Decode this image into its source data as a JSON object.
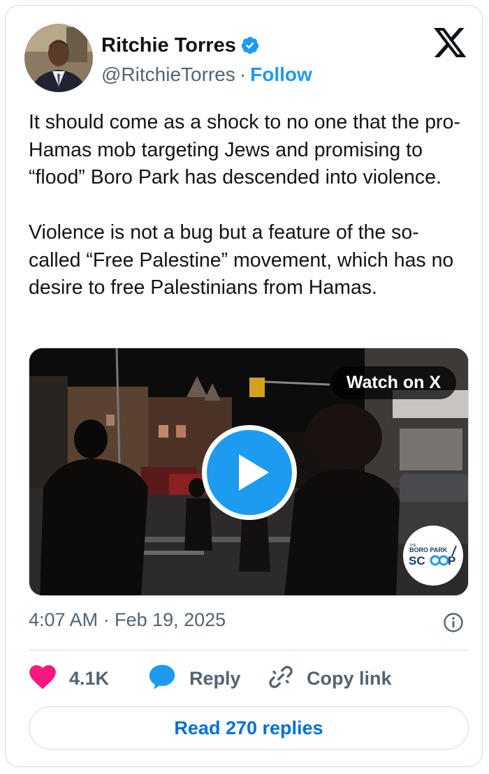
{
  "author": {
    "name": "Ritchie Torres",
    "handle": "@RitchieTorres",
    "separator": "·",
    "follow_label": "Follow"
  },
  "tweet": {
    "paragraphs": [
      "It should come as a shock to no one that the pro-Hamas mob targeting Jews and promising to “flood” Boro Park has descended into violence.",
      "Violence is not a bug but a feature of the so-called “Free Palestine” movement, which has no desire to free Palestinians from Hamas."
    ]
  },
  "media": {
    "watch_label": "Watch on X",
    "watermark_small": "THE",
    "watermark_top": "BORO PARK",
    "watermark_bottom": "SCOOP"
  },
  "timestamp": "4:07 AM · Feb 19, 2025",
  "actions": {
    "like_count": "4.1K",
    "reply_label": "Reply",
    "copy_label": "Copy link"
  },
  "read_replies_label": "Read 270 replies",
  "colors": {
    "accent": "#1d9bf0",
    "like": "#f91880",
    "link_button": "#006fd6",
    "muted": "#536471"
  },
  "icons": [
    "verified-badge-icon",
    "x-logo-icon",
    "play-icon",
    "info-icon",
    "heart-icon",
    "reply-bubble-icon",
    "link-icon"
  ]
}
